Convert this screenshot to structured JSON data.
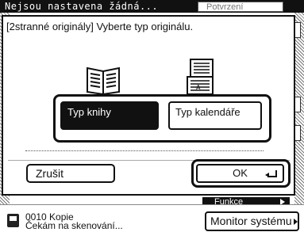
{
  "background": {
    "title_text": "Nejsou nastavena žádná...",
    "confirm_label": "Potvrzení",
    "function_label": "Funkce"
  },
  "dialog": {
    "message": "[2stranné originály] Vyberte typ originálu.",
    "options": [
      {
        "label": "Typ knihy",
        "selected": true,
        "icon": "book-icon"
      },
      {
        "label": "Typ kalendáře",
        "selected": false,
        "icon": "calendar-icon"
      }
    ],
    "cancel_label": "Zrušit",
    "ok_label": "OK"
  },
  "status_bar": {
    "job_line1": "0010 Kopie",
    "job_line2": "Čekám na skenování...",
    "monitor_label": "Monitor systému"
  },
  "colors": {
    "selected_bg": "#111111",
    "frame": "#111111",
    "background": "#ffffff"
  }
}
